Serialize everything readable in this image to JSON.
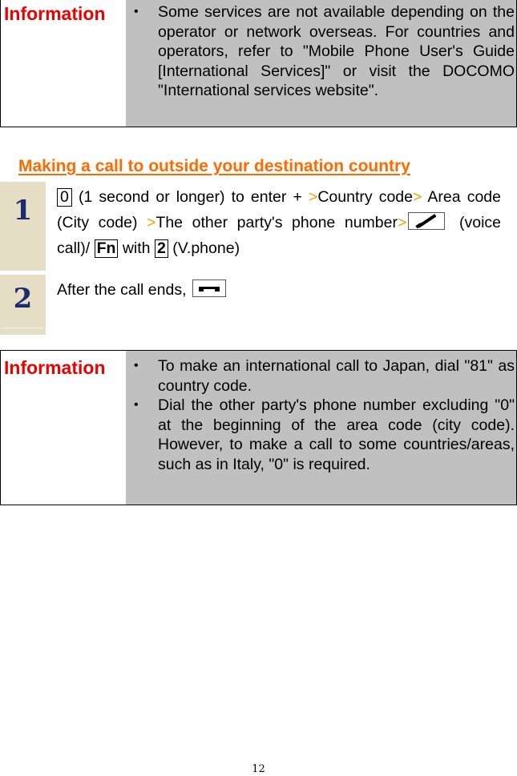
{
  "info_box_1": {
    "label": "Information",
    "bullets": [
      "Some services are not available depending on the operator or network overseas. For countries and operators, refer to \"Mobile Phone User's Guide [International Services]\" or visit the DOCOMO \"International services website\"."
    ]
  },
  "section": {
    "title": "Making a call to outside your destination country"
  },
  "steps": [
    {
      "number": "1",
      "key_zero": "0",
      "text_a": " (1 second or longer) to enter + ",
      "arrow": ">",
      "text_b": "Country code",
      "text_c": "Area code (City code) ",
      "text_d": "The other party's phone number",
      "text_e": " (voice call)/ ",
      "key_fn": "Fn",
      "text_f": " with ",
      "key_two": "2",
      "text_g": " (V.phone)",
      "call_icon": "call-start-icon"
    },
    {
      "number": "2",
      "text": "After the call ends, ",
      "end_icon": "call-end-icon"
    }
  ],
  "info_box_2": {
    "label": "Information",
    "bullets": [
      "To make an international call to Japan, dial \"81\" as country code.",
      "Dial the other party's phone number excluding \"0\" at the beginning of the area code (city code). However, to make a call to some countries/areas, such as in Italy, \"0\" is required."
    ]
  },
  "bullet_glyph": "•",
  "page_number": "12",
  "colors": {
    "info_label": "#ee0000",
    "section_title": "#ff6a00",
    "arrow": "#f5a000",
    "step_bg": "#e6dec4",
    "step_number": "#1c2a6e",
    "info_body_bg": "#c0c0c0"
  }
}
